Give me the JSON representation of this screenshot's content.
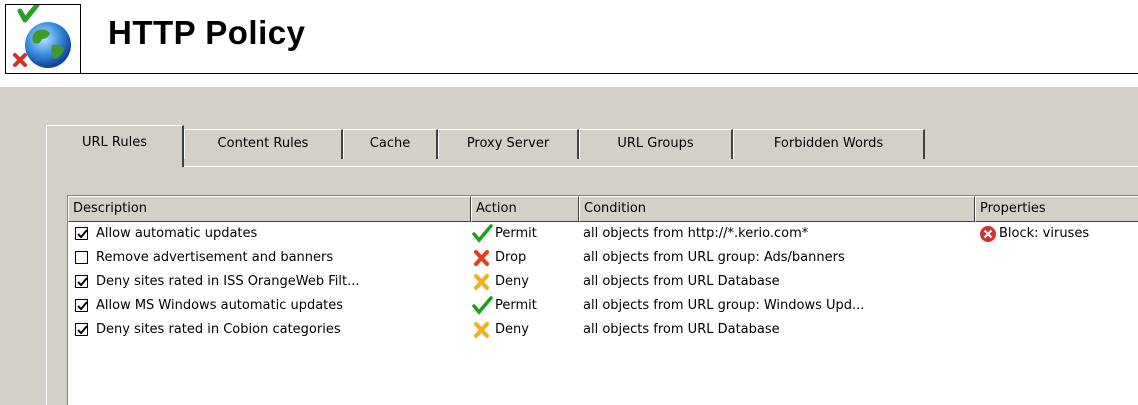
{
  "header": {
    "title": "HTTP Policy",
    "icon": "globe-policy-icon"
  },
  "tabs": [
    {
      "label": "URL Rules",
      "active": true
    },
    {
      "label": "Content Rules",
      "active": false
    },
    {
      "label": "Cache",
      "active": false
    },
    {
      "label": "Proxy Server",
      "active": false
    },
    {
      "label": "URL Groups",
      "active": false
    },
    {
      "label": "Forbidden Words",
      "active": false
    }
  ],
  "table": {
    "columns": [
      "Description",
      "Action",
      "Condition",
      "Properties"
    ],
    "rows": [
      {
        "checked": true,
        "description": "Allow automatic updates",
        "action": "Permit",
        "action_icon": "permit-check-icon",
        "condition": "all objects from http://*.kerio.com*",
        "properties": "Block: viruses",
        "properties_icon": "block-x-icon"
      },
      {
        "checked": false,
        "description": "Remove advertisement and banners",
        "action": "Drop",
        "action_icon": "drop-x-icon",
        "condition": "all objects from URL group: Ads/banners",
        "properties": "",
        "properties_icon": ""
      },
      {
        "checked": true,
        "description": "Deny sites rated in ISS OrangeWeb Filt...",
        "action": "Deny",
        "action_icon": "deny-x-icon",
        "condition": "all objects from URL Database",
        "properties": "",
        "properties_icon": ""
      },
      {
        "checked": true,
        "description": "Allow MS Windows automatic updates",
        "action": "Permit",
        "action_icon": "permit-check-icon",
        "condition": "all objects from URL group: Windows Upd...",
        "properties": "",
        "properties_icon": ""
      },
      {
        "checked": true,
        "description": "Deny sites rated in Cobion categories",
        "action": "Deny",
        "action_icon": "deny-x-icon",
        "condition": "all objects from URL Database",
        "properties": "",
        "properties_icon": ""
      }
    ]
  },
  "colors": {
    "panel": "#d4d0c8",
    "permit": "#1aa01a",
    "drop": "#e0401a",
    "deny": "#f0b020",
    "block": "#d83030"
  }
}
